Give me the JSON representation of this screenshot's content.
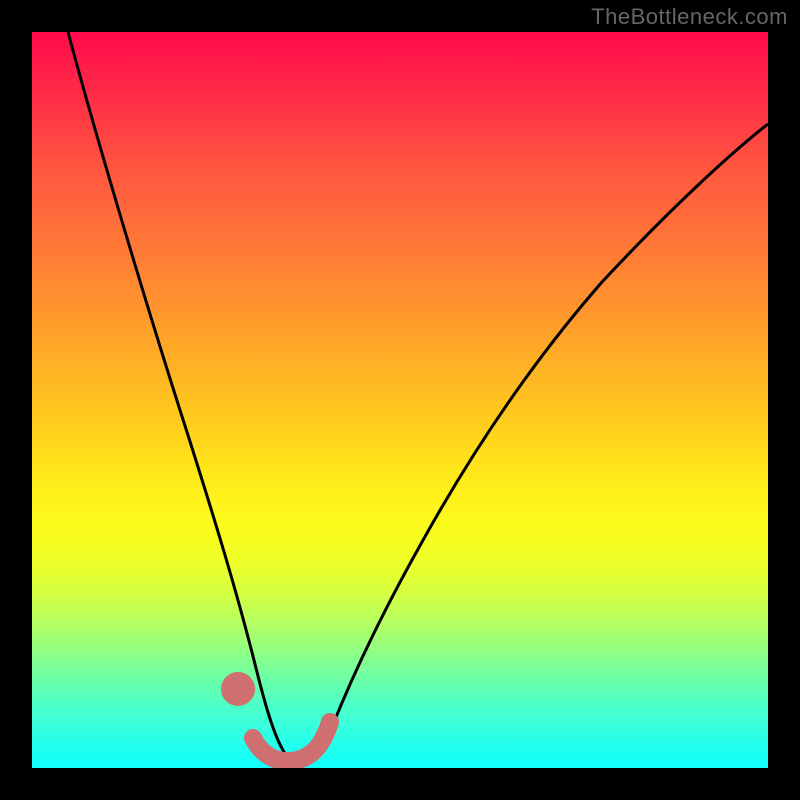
{
  "watermark": "TheBottleneck.com",
  "chart_data": {
    "type": "line",
    "title": "",
    "xlabel": "",
    "ylabel": "",
    "ylim": [
      0,
      100
    ],
    "xlim": [
      0,
      100
    ],
    "series": [
      {
        "name": "bottleneck-curve",
        "x": [
          5,
          8,
          12,
          16,
          20,
          24,
          27,
          29,
          31,
          33,
          34,
          36,
          38,
          40,
          43,
          48,
          55,
          63,
          72,
          82,
          92,
          100
        ],
        "y": [
          100,
          86,
          70,
          54,
          38,
          24,
          14,
          8,
          4,
          2,
          1.5,
          1.5,
          2,
          3,
          6,
          12,
          22,
          34,
          46,
          58,
          68,
          76
        ]
      }
    ],
    "markers": {
      "name": "highlight-band",
      "color": "#d07070",
      "x": [
        27.5,
        29,
        30,
        31,
        32,
        33,
        34,
        35,
        36,
        37,
        38,
        39
      ],
      "y": [
        10,
        4.5,
        3.5,
        3,
        2.6,
        2.5,
        2.5,
        2.6,
        3,
        3.5,
        4.5,
        7
      ]
    },
    "background_gradient": [
      "#ff0a4a",
      "#ffe81a",
      "#10fffb"
    ]
  }
}
